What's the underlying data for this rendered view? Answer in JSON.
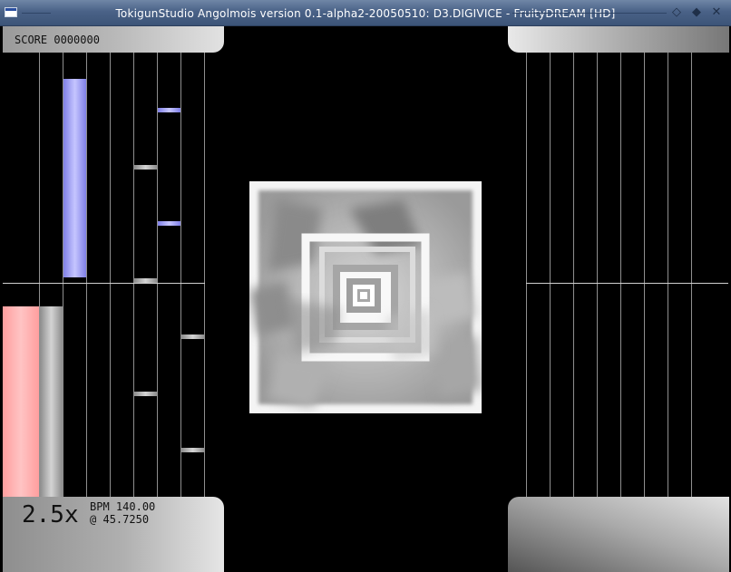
{
  "window": {
    "title": "TokigunStudio Angolmois version 0.1-alpha2-20050510: D3.DIGIVICE - FruityDREAM [HD]"
  },
  "hud": {
    "score_label": "SCORE",
    "score_value": "0000000",
    "speed": "2.5x",
    "bpm_label": "BPM",
    "bpm_value": "140.00",
    "position_prefix": "@",
    "position_value": "45.7250"
  },
  "colors": {
    "blue_note": "#a3a3ff",
    "red_lane": "#ffa3a3",
    "gray_note": "#bdbdbd",
    "lane_line": "#9a9a9a"
  }
}
